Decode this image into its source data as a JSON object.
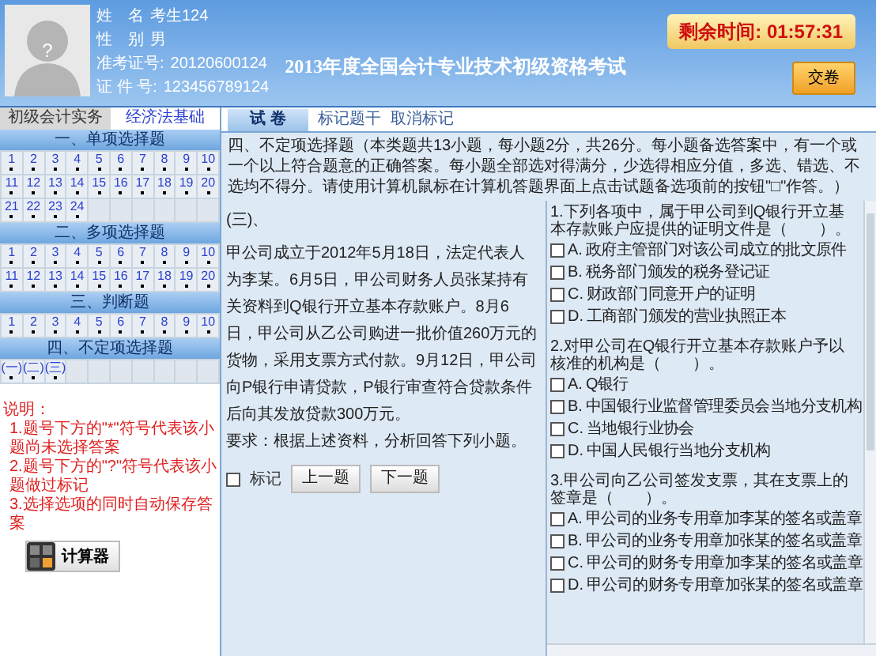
{
  "candidate": {
    "photo_placeholder": "?",
    "fields": [
      {
        "label": "姓　名",
        "value": "考生124"
      },
      {
        "label": "性　别",
        "value": "男"
      },
      {
        "label": "准考证号:",
        "value": "20120600124"
      },
      {
        "label": "证 件 号:",
        "value": "123456789124"
      }
    ]
  },
  "exam_title": "2013年度全国会计专业技术初级资格考试",
  "timer": "剩余时间: 01:57:31",
  "submit_button": "交卷",
  "subject_tabs": [
    {
      "label": "初级会计实务",
      "selected": false
    },
    {
      "label": "经济法基础",
      "selected": true
    }
  ],
  "sections": [
    {
      "title": "一、单项选择题",
      "items": [
        {
          "label": "1",
          "answered": false
        },
        {
          "label": "2",
          "answered": false
        },
        {
          "label": "3",
          "answered": false
        },
        {
          "label": "4",
          "answered": false
        },
        {
          "label": "5",
          "answered": false
        },
        {
          "label": "6",
          "answered": false
        },
        {
          "label": "7",
          "answered": false
        },
        {
          "label": "8",
          "answered": false
        },
        {
          "label": "9",
          "answered": false
        },
        {
          "label": "10",
          "answered": false
        },
        {
          "label": "11",
          "answered": false
        },
        {
          "label": "12",
          "answered": false
        },
        {
          "label": "13",
          "answered": false
        },
        {
          "label": "14",
          "answered": false
        },
        {
          "label": "15",
          "answered": false
        },
        {
          "label": "16",
          "answered": false
        },
        {
          "label": "17",
          "answered": false
        },
        {
          "label": "18",
          "answered": false
        },
        {
          "label": "19",
          "answered": false
        },
        {
          "label": "20",
          "answered": false
        },
        {
          "label": "21",
          "answered": false
        },
        {
          "label": "22",
          "answered": false
        },
        {
          "label": "23",
          "answered": false
        },
        {
          "label": "24",
          "answered": false
        }
      ]
    },
    {
      "title": "二、多项选择题",
      "items": [
        {
          "label": "1",
          "answered": false
        },
        {
          "label": "2",
          "answered": false
        },
        {
          "label": "3",
          "answered": false
        },
        {
          "label": "4",
          "answered": false
        },
        {
          "label": "5",
          "answered": false
        },
        {
          "label": "6",
          "answered": false
        },
        {
          "label": "7",
          "answered": false
        },
        {
          "label": "8",
          "answered": false
        },
        {
          "label": "9",
          "answered": false
        },
        {
          "label": "10",
          "answered": false
        },
        {
          "label": "11",
          "answered": false
        },
        {
          "label": "12",
          "answered": false
        },
        {
          "label": "13",
          "answered": false
        },
        {
          "label": "14",
          "answered": false
        },
        {
          "label": "15",
          "answered": false
        },
        {
          "label": "16",
          "answered": false
        },
        {
          "label": "17",
          "answered": false
        },
        {
          "label": "18",
          "answered": false
        },
        {
          "label": "19",
          "answered": false
        },
        {
          "label": "20",
          "answered": false
        }
      ]
    },
    {
      "title": "三、判断题",
      "items": [
        {
          "label": "1",
          "answered": false
        },
        {
          "label": "2",
          "answered": false
        },
        {
          "label": "3",
          "answered": false
        },
        {
          "label": "4",
          "answered": false
        },
        {
          "label": "5",
          "answered": false
        },
        {
          "label": "6",
          "answered": false
        },
        {
          "label": "7",
          "answered": false
        },
        {
          "label": "8",
          "answered": false
        },
        {
          "label": "9",
          "answered": false
        },
        {
          "label": "10",
          "answered": false
        }
      ]
    },
    {
      "title": "四、不定项选择题",
      "items": [
        {
          "label": "(一)",
          "answered": false
        },
        {
          "label": "(二)",
          "answered": false
        },
        {
          "label": "(三)",
          "answered": false
        }
      ]
    }
  ],
  "notes": {
    "title": "说明：",
    "lines": [
      "1.题号下方的\"*\"符号代表该小题尚未选择答案",
      "2.题号下方的\"?\"符号代表该小题做过标记",
      "3.选择选项的同时自动保存答案"
    ]
  },
  "calculator_button": "计算器",
  "paper_tabs": [
    {
      "label": "试 卷",
      "selected": true
    },
    {
      "label": "标记题干",
      "selected": false
    },
    {
      "label": "取消标记",
      "selected": false
    }
  ],
  "instructions": "四、不定项选择题（本类题共13小题，每小题2分，共26分。每小题备选答案中，有一个或一个以上符合题意的正确答案。每小题全部选对得满分，少选得相应分值，多选、错选、不选均不得分。请使用计算机鼠标在计算机答题界面上点击试题备选项前的按钮\"□\"作答。）",
  "case": {
    "number": "(三)、",
    "passage": "甲公司成立于2012年5月18日，法定代表人为李某。6月5日，甲公司财务人员张某持有关资料到Q银行开立基本存款账户。8月6日，甲公司从乙公司购进一批价值260万元的货物，采用支票方式付款。9月12日，甲公司向P银行申请贷款，P银行审查符合贷款条件后向其发放贷款300万元。",
    "requirement": "要求：根据上述资料，分析回答下列小题。",
    "mark": {
      "label": "标记",
      "checked": false
    },
    "buttons": [
      "上一题",
      "下一题"
    ]
  },
  "questions": [
    {
      "text": "1.下列各项中，属于甲公司到Q银行开立基本存款账户应提供的证明文件是（　　）。",
      "options": [
        {
          "letter": "A.",
          "text": "政府主管部门对该公司成立的批文原件",
          "checked": false
        },
        {
          "letter": "B.",
          "text": "税务部门颁发的税务登记证",
          "checked": false
        },
        {
          "letter": "C.",
          "text": "财政部门同意开户的证明",
          "checked": false
        },
        {
          "letter": "D.",
          "text": "工商部门颁发的营业执照正本",
          "checked": false
        }
      ]
    },
    {
      "text": "2.对甲公司在Q银行开立基本存款账户予以核准的机构是（　　）。",
      "options": [
        {
          "letter": "A.",
          "text": "Q银行",
          "checked": false
        },
        {
          "letter": "B.",
          "text": "中国银行业监督管理委员会当地分支机构",
          "checked": false
        },
        {
          "letter": "C.",
          "text": "当地银行业协会",
          "checked": false
        },
        {
          "letter": "D.",
          "text": "中国人民银行当地分支机构",
          "checked": false
        }
      ]
    },
    {
      "text": "3.甲公司向乙公司签发支票，其在支票上的签章是（　　）。",
      "options": [
        {
          "letter": "A.",
          "text": "甲公司的业务专用章加李某的签名或盖章",
          "checked": false
        },
        {
          "letter": "B.",
          "text": "甲公司的业务专用章加张某的签名或盖章",
          "checked": false
        },
        {
          "letter": "C.",
          "text": "甲公司的财务专用章加李某的签名或盖章",
          "checked": false
        },
        {
          "letter": "D.",
          "text": "甲公司的财务专用章加张某的签名或盖章",
          "checked": false
        }
      ]
    }
  ]
}
